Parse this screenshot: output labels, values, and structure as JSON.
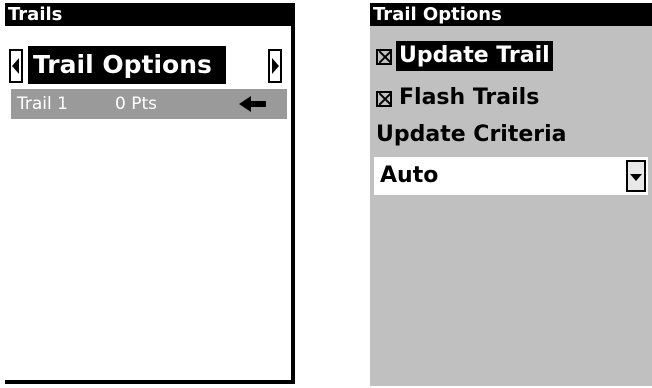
{
  "trails_screen": {
    "title": "Trails",
    "tab": {
      "title": "Trail Options",
      "prev_icon": "arrow-left-icon",
      "next_icon": "arrow-right-icon"
    },
    "trail_list": [
      {
        "name": "Trail 1",
        "points": "0 Pts",
        "pointer_icon": "pointer-arrow-icon"
      }
    ],
    "colors": {
      "selected_row_bg": "#9a9a9a",
      "titlebar_bg": "#000000"
    }
  },
  "trail_options_screen": {
    "title": "Trail Options",
    "options": [
      {
        "label": "Update Trail",
        "checked": true,
        "focused": true
      },
      {
        "label": "Flash Trails",
        "checked": true,
        "focused": false
      }
    ],
    "criteria_heading": "Update Criteria",
    "criteria_select": {
      "value": "Auto",
      "dropdown_icon": "chevron-down-icon"
    },
    "colors": {
      "background": "#c0c0c0",
      "focus_bg": "#000000"
    }
  }
}
